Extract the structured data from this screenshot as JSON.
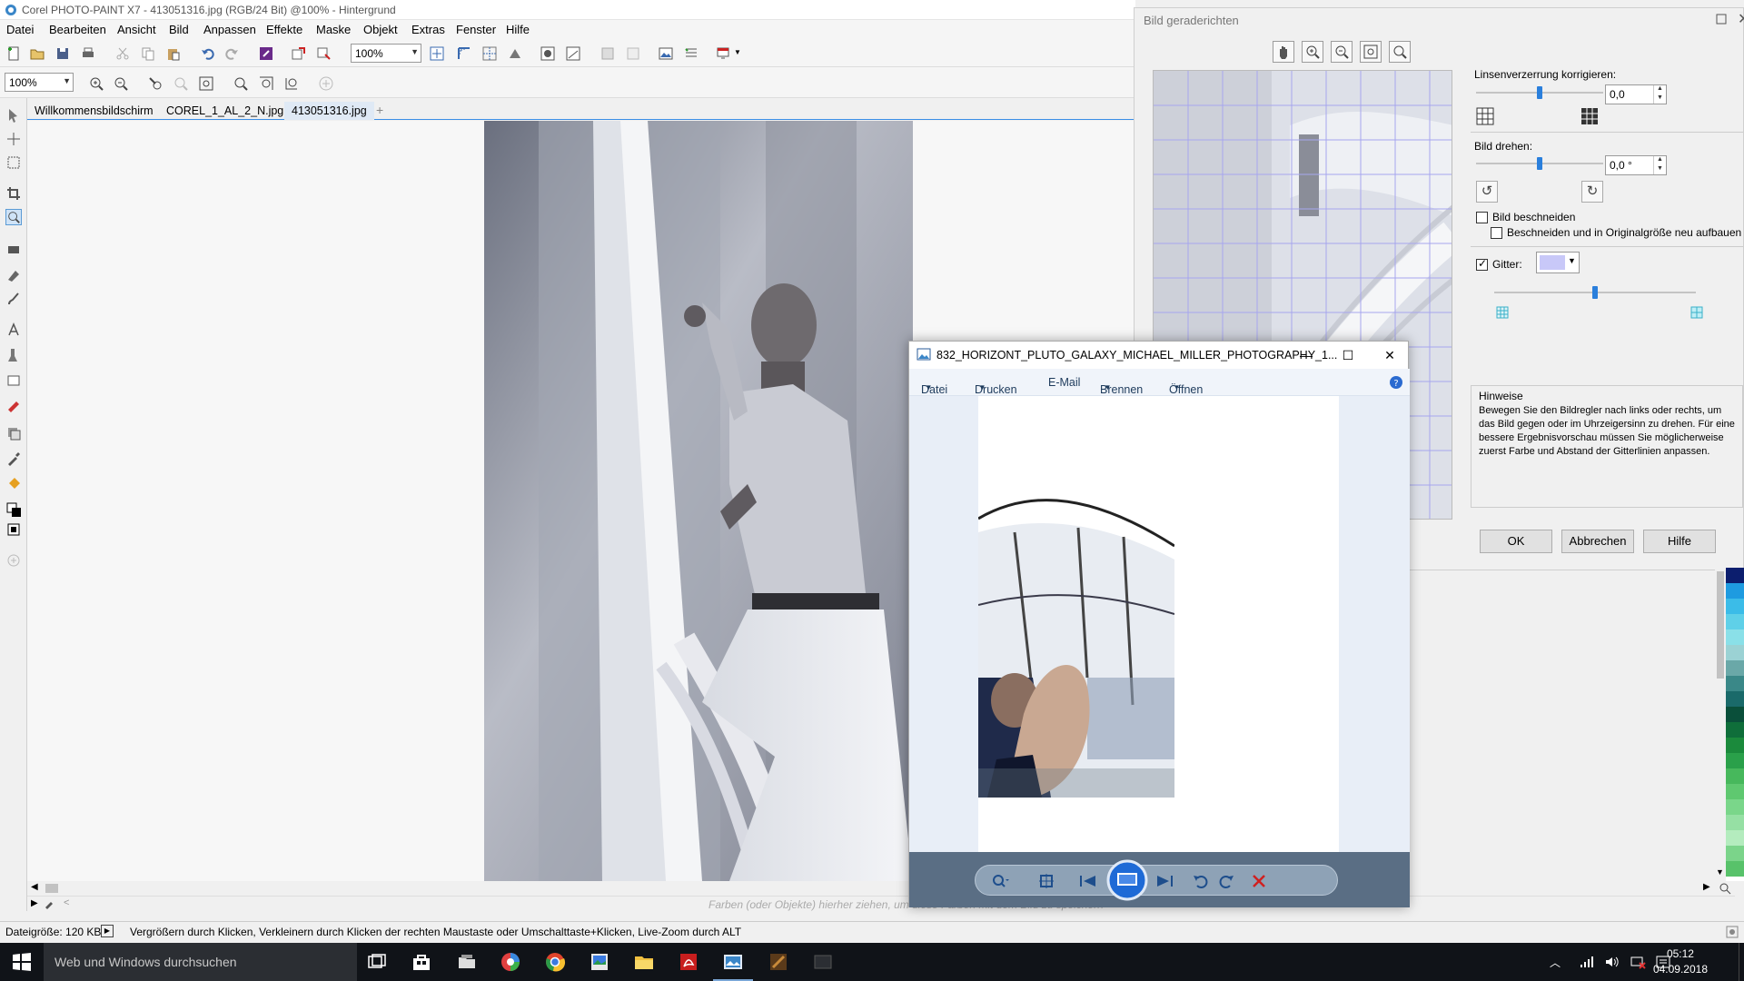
{
  "app": {
    "title": "Corel PHOTO-PAINT X7 - 413051316.jpg (RGB/24 Bit) @100% - Hintergrund"
  },
  "menu": [
    "Datei",
    "Bearbeiten",
    "Ansicht",
    "Bild",
    "Anpassen",
    "Effekte",
    "Maske",
    "Objekt",
    "Extras",
    "Fenster",
    "Hilfe"
  ],
  "toolbar": {
    "zoom_value": "100%",
    "zoom_value_2": "100%"
  },
  "doc_tabs": [
    {
      "label": "Willkommensbildschirm",
      "active": false
    },
    {
      "label": "COREL_1_AL_2_N.jpg",
      "active": false
    },
    {
      "label": "413051316.jpg",
      "active": true
    }
  ],
  "status": {
    "file_size": "Dateigröße: 120 KB",
    "hint": "Vergrößern durch Klicken, Verkleinern durch Klicken der rechten Maustaste oder Umschalttaste+Klicken, Live-Zoom durch ALT"
  },
  "palette_hint": "Farben (oder Objekte) hierher ziehen, um diese Farben mit dem Bild zu speichern",
  "straighten_dialog": {
    "title": "Bild geraderichten",
    "lens_label": "Linsenverzerrung korrigieren:",
    "lens_value": "0,0",
    "lens_level": 0.5,
    "rotate_label": "Bild drehen:",
    "rotate_value": "0,0 °",
    "rotate_level": 0.5,
    "crop_label": "Bild beschneiden",
    "crop_checked": false,
    "crop_resize_label": "Beschneiden und in Originalgröße neu aufbauen",
    "crop_resize_checked": false,
    "grid_label": "Gitter:",
    "grid_checked": true,
    "grid_color": "#c8c8f8",
    "grid_spacing_level": 0.5,
    "hints_title": "Hinweise",
    "hints_text": "Bewegen Sie den Bildregler nach links oder rechts, um das Bild gegen oder im Uhrzeigersinn zu drehen. Für eine bessere Ergebnisvorschau müssen Sie möglicherweise zuerst Farbe und Abstand der Gitterlinien anpassen.",
    "ok": "OK",
    "cancel": "Abbrechen",
    "help": "Hilfe"
  },
  "photo_viewer": {
    "title": "832_HORIZONT_PLUTO_GALAXY_MICHAEL_MILLER_PHOTOGRAPHY_1...",
    "menu": [
      {
        "label": "Datei",
        "dropdown": true
      },
      {
        "label": "Drucken",
        "dropdown": true
      },
      {
        "label": "E-Mail",
        "dropdown": false
      },
      {
        "label": "Brennen",
        "dropdown": true
      },
      {
        "label": "Öffnen",
        "dropdown": true
      }
    ]
  },
  "right_palette": [
    "#0c1e6e",
    "#1e9be0",
    "#3bbce8",
    "#5fd0e8",
    "#8ae0e8",
    "#9bd2d4",
    "#6aa8a8",
    "#3a8888",
    "#1a6a6a",
    "#0a4f3a",
    "#0f6e3a",
    "#1b8a3c",
    "#2aa04a",
    "#47b85c",
    "#5fc870",
    "#7ad68a",
    "#96e0a4",
    "#b4ecbe",
    "#7bd48a",
    "#58c26a"
  ],
  "taskbar": {
    "search_placeholder": "Web und Windows durchsuchen",
    "time": "05:12",
    "date": "04.09.2018"
  }
}
